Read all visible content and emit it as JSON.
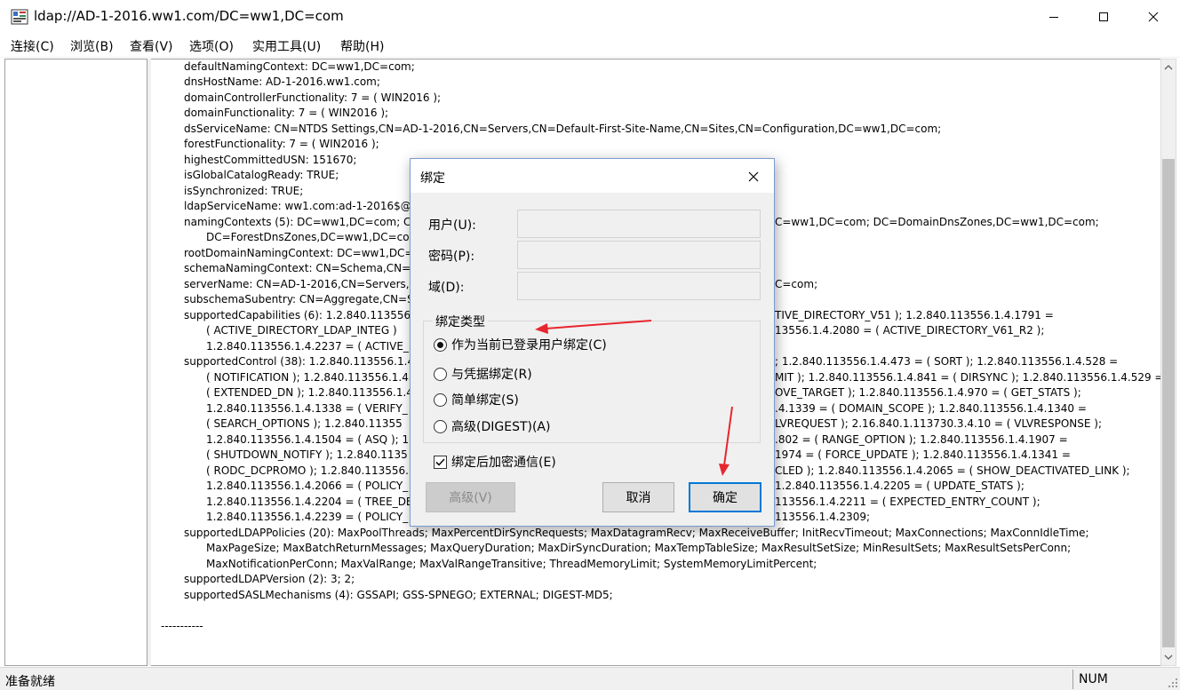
{
  "window": {
    "title": "ldap://AD-1-2016.ww1.com/DC=ww1,DC=com",
    "app_icon": "ldp-app-icon",
    "controls": [
      "minimize-icon",
      "maximize-icon",
      "close-icon"
    ]
  },
  "menu": {
    "items": [
      {
        "label": "连接(C)"
      },
      {
        "label": "浏览(B)"
      },
      {
        "label": "查看(V)"
      },
      {
        "label": "选项(O)"
      },
      {
        "label": "实用工具(U)"
      },
      {
        "label": "帮助(H)"
      }
    ]
  },
  "content": {
    "lines": [
      "defaultNamingContext: DC=ww1,DC=com;",
      "dnsHostName: AD-1-2016.ww1.com;",
      "domainControllerFunctionality: 7 = ( WIN2016 );",
      "domainFunctionality: 7 = ( WIN2016 );",
      "dsServiceName: CN=NTDS Settings,CN=AD-1-2016,CN=Servers,CN=Default-First-Site-Name,CN=Sites,CN=Configuration,DC=ww1,DC=com;",
      "forestFunctionality: 7 = ( WIN2016 );",
      "highestCommittedUSN: 151670;",
      "isGlobalCatalogReady: TRUE;",
      "isSynchronized: TRUE;",
      "ldapServiceName: ww1.com:ad-1-2016$@",
      "namingContexts (5): DC=ww1,DC=com; C",
      "DC=ForestDnsZones,DC=ww1,DC=co",
      "rootDomainNamingContext: DC=ww1,DC=",
      "schemaNamingContext: CN=Schema,CN=C",
      "serverName: CN=AD-1-2016,CN=Servers,",
      "subschemaSubentry: CN=Aggregate,CN=S",
      "supportedCapabilities (6): 1.2.840.113556.",
      "( ACTIVE_DIRECTORY_LDAP_INTEG )",
      "1.2.840.113556.1.4.2237 = ( ACTIVE_",
      "supportedControl (38): 1.2.840.113556.1.4",
      "( NOTIFICATION ); 1.2.840.113556.1.4",
      "( EXTENDED_DN ); 1.2.840.113556.1.4",
      "1.2.840.113556.1.4.1338 = ( VERIFY_",
      "( SEARCH_OPTIONS ); 1.2.840.11355",
      "1.2.840.113556.1.4.1504 = ( ASQ ); 1.",
      "( SHUTDOWN_NOTIFY ); 1.2.840.1135",
      "( RODC_DCPROMO ); 1.2.840.113556.",
      "1.2.840.113556.1.4.2066 = ( POLICY_",
      "1.2.840.113556.1.4.2204 = ( TREE_DE",
      "1.2.840.113556.1.4.2239 = ( POLICY_",
      "supportedLDAPPolicies (20): MaxPoolThreads; MaxPercentDirSyncRequests; MaxDatagramRecv; MaxReceiveBuffer; InitRecvTimeout; MaxConnections; MaxConnIdleTime;",
      "MaxPageSize; MaxBatchReturnMessages; MaxQueryDuration; MaxDirSyncDuration; MaxTempTableSize; MaxResultSetSize; MinResultSets; MaxResultSetsPerConn;",
      "MaxNotificationPerConn; MaxValRange; MaxValRangeTransitive; ThreadMemoryLimit; SystemMemoryLimitPercent;",
      "supportedLDAPVersion (2): 3; 2;",
      "supportedSASLMechanisms (4): GSSAPI; GSS-SPNEGO; EXTERNAL; DIGEST-MD5;",
      "-----------"
    ],
    "right_fragments": [
      "C=ww1,DC=com; DC=DomainDnsZones,DC=ww1,DC=com;",
      "C=com;",
      "TIVE_DIRECTORY_V51 ); 1.2.840.113556.1.4.1791 =",
      "13556.1.4.2080 = ( ACTIVE_DIRECTORY_V61_R2 );",
      "; 1.2.840.113556.1.4.473 = ( SORT ); 1.2.840.113556.1.4.528 =",
      "MIT ); 1.2.840.113556.1.4.841 = ( DIRSYNC ); 1.2.840.113556.1.4.529 =",
      "OVE_TARGET ); 1.2.840.113556.1.4.970 = ( GET_STATS );",
      ".4.1339 = ( DOMAIN_SCOPE ); 1.2.840.113556.1.4.1340 =",
      "LVREQUEST ); 2.16.840.1.113730.3.4.10 = ( VLVRESPONSE );",
      ".802 = ( RANGE_OPTION ); 1.2.840.113556.1.4.1907 =",
      "1974 = ( FORCE_UPDATE ); 1.2.840.113556.1.4.1341 =",
      "CLED ); 1.2.840.113556.1.4.2065 = ( SHOW_DEACTIVATED_LINK );",
      "1.2.840.113556.1.4.2205 = ( UPDATE_STATS );",
      "113556.1.4.2211 = ( EXPECTED_ENTRY_COUNT );",
      "113556.1.4.2309;"
    ]
  },
  "dialog": {
    "title": "绑定",
    "fields": {
      "user_label": "用户(U):",
      "user_value": "",
      "password_label": "密码(P):",
      "password_value": "",
      "domain_label": "域(D):",
      "domain_value": ""
    },
    "bind_type": {
      "legend": "绑定类型",
      "options": [
        {
          "label": "作为当前已登录用户绑定(C)",
          "checked": true
        },
        {
          "label": "与凭据绑定(R)",
          "checked": false
        },
        {
          "label": "简单绑定(S)",
          "checked": false
        },
        {
          "label": "高级(DIGEST)(A)",
          "checked": false
        }
      ]
    },
    "encrypt": {
      "label": "绑定后加密通信(E)",
      "checked": true
    },
    "buttons": {
      "advanced": "高级(V)",
      "cancel": "取消",
      "ok": "确定"
    }
  },
  "status": {
    "text": "准备就绪",
    "num": "NUM"
  },
  "colors": {
    "annotation_arrow": "#e8262e",
    "focus_border": "#0078d7"
  }
}
